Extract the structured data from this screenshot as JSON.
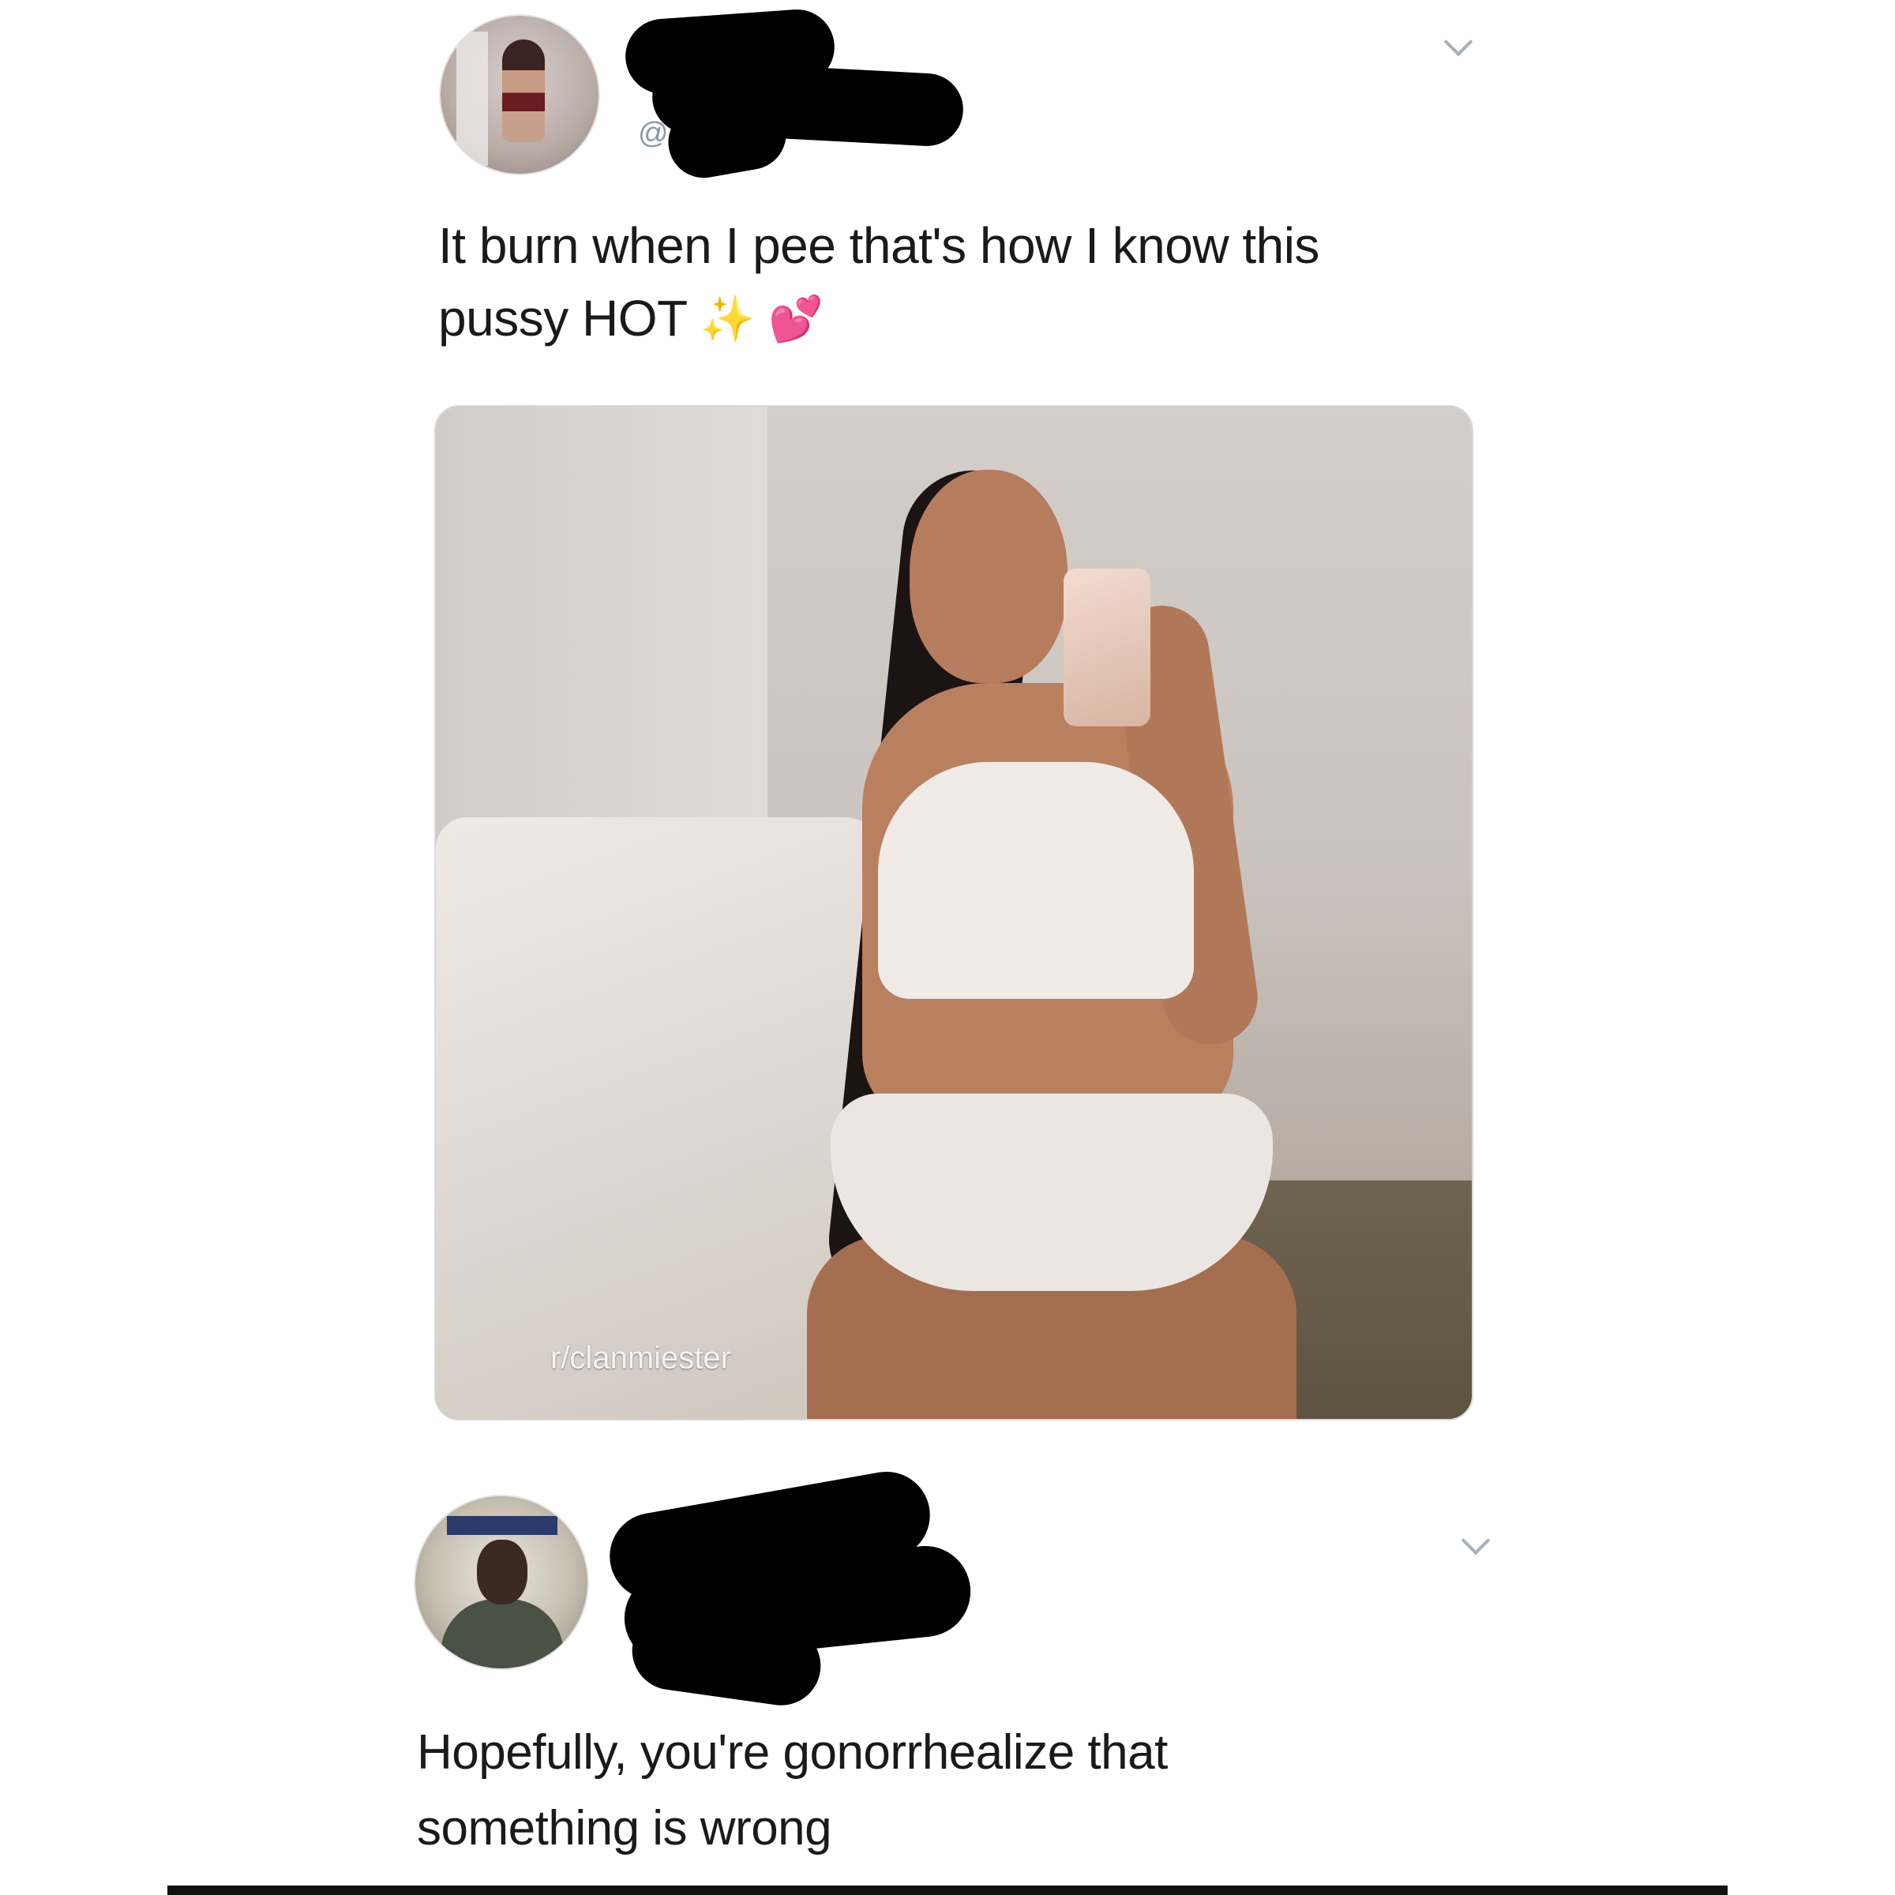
{
  "post": {
    "text_line1": "It burn when I pee that's how I know this",
    "text_line2": "pussy HOT",
    "emoji_sparkles": "✨",
    "emoji_hearts": "💕",
    "handle_prefix": "@",
    "image_watermark": "r/clanmiester"
  },
  "reply": {
    "text_line1": "Hopefully,  you're gonorrhealize that",
    "text_line2": "something is wrong"
  },
  "icons": {
    "menu": "chevron-down-icon"
  }
}
